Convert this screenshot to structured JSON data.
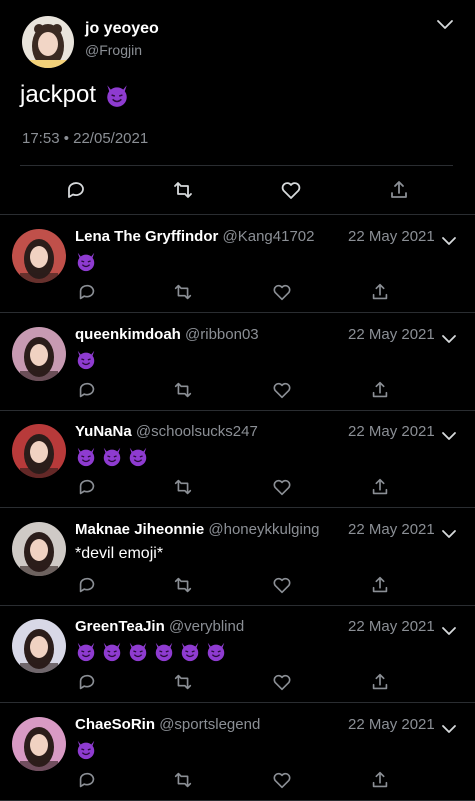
{
  "main_tweet": {
    "name": "jo yeoyeo",
    "handle": "@Frogjin",
    "text": "jackpot",
    "timestamp": "17:53 • 22/05/2021",
    "emoji": "smiling-imp"
  },
  "replies": [
    {
      "name": "Lena The Gryffindor",
      "handle": "@Kang41702",
      "date": "22 May 2021",
      "text": "",
      "devils": 1,
      "avatar_color": "#c0504a"
    },
    {
      "name": "queenkimdoah",
      "handle": "@ribbon03",
      "date": "22 May 2021",
      "text": "",
      "devils": 1,
      "avatar_color": "#c79ab2"
    },
    {
      "name": "YuNaNa",
      "handle": "@schoolsucks247",
      "date": "22 May 2021",
      "text": "",
      "devils": 3,
      "avatar_color": "#b83a3a"
    },
    {
      "name": "Maknae Jiheonnie",
      "handle": "@honeykkulging",
      "date": "22 May 2021",
      "text": "*devil emoji*",
      "devils": 0,
      "avatar_color": "#cfcac6"
    },
    {
      "name": "GreenTeaJin",
      "handle": "@veryblind",
      "date": "22 May 2021",
      "text": "",
      "devils": 6,
      "avatar_color": "#d8d8e6"
    },
    {
      "name": "ChaeSoRin",
      "handle": "@sportslegend",
      "date": "22 May 2021",
      "text": "",
      "devils": 1,
      "avatar_color": "#d89ac4"
    }
  ],
  "colors": {
    "background": "#000000",
    "muted": "#8b8f95",
    "separator": "#2a2d31",
    "emoji_purple": "#8e3bd0"
  }
}
